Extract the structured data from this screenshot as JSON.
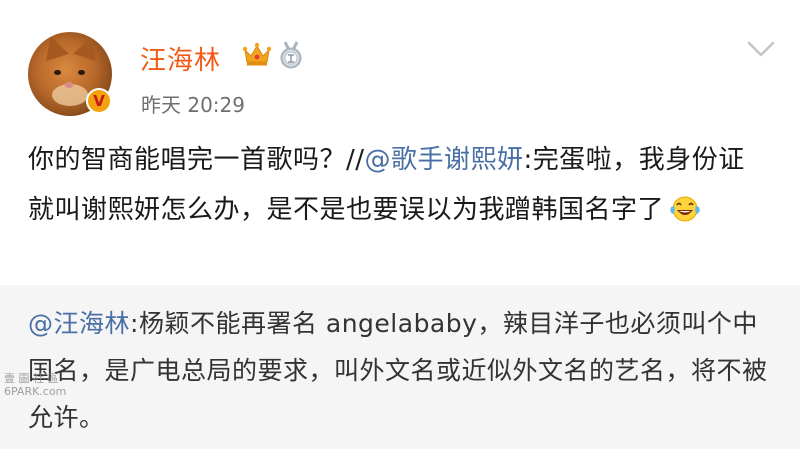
{
  "post": {
    "username": "汪海林",
    "timestamp": "昨天 20:29",
    "text_before_mention": "你的智商能唱完一首歌吗？//",
    "mention": "@歌手谢熙妍",
    "text_after_mention": ":完蛋啦，我身份证就叫谢熙妍怎么办，是不是也要误以为我蹭韩国名字了",
    "emoji": "laugh-cry-emoji"
  },
  "quote": {
    "mention": "@汪海林",
    "text": ":杨颖不能再署名 angelababy，辣目洋子也必须叫个中国名，是广电总局的要求，叫外文名或近似外文名的艺名，将不被允许。"
  },
  "watermark": {
    "line1": "壹 圖 社 區",
    "line2": "6PARK.com"
  },
  "colors": {
    "username": "#f45a15",
    "mention": "#4a6fa5",
    "quote_bg": "#f5f5f5",
    "verified": "#f3a20d"
  },
  "icons": [
    "crown-icon",
    "medal-icon",
    "chevron-down-icon",
    "verified-v-icon"
  ]
}
